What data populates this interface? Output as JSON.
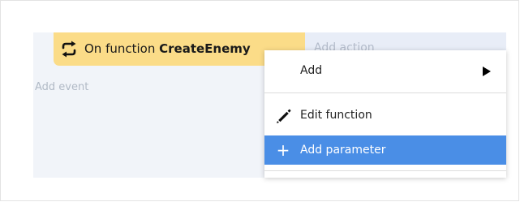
{
  "event_block": {
    "prefix": "On function",
    "function_name": "CreateEnemy",
    "add_action_label": "Add action",
    "add_event_label": "Add event"
  },
  "context_menu": {
    "items": [
      {
        "label": "Add",
        "icon": "submenu-arrow-icon",
        "has_submenu": true
      },
      {
        "label": "Edit function",
        "icon": "pencil-icon"
      },
      {
        "label": "Add parameter",
        "icon": "plus-icon",
        "highlighted": true
      }
    ],
    "highlight_color": "#4a8ee6"
  },
  "colors": {
    "event_block_bg": "#fbdc88",
    "sheet_bg": "#f1f4f9",
    "actions_bg": "#e8edf7"
  }
}
